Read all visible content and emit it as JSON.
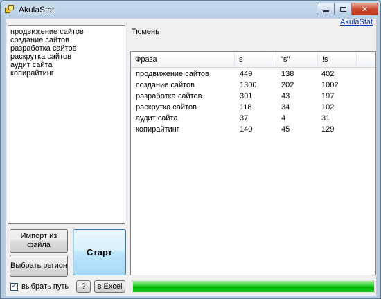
{
  "window": {
    "title": "AkulaStat",
    "controls": {
      "minimize": "",
      "maximize": "",
      "close": "✕"
    }
  },
  "link": "AkulaStat",
  "region_label": "Тюмень",
  "phrases": [
    "продвижение сайтов",
    "создание сайтов",
    "разработка сайтов",
    "раскрутка сайтов",
    "аудит сайта",
    "копирайтинг"
  ],
  "results": {
    "columns": [
      "Фраза",
      "s",
      "\"s\"",
      "!s"
    ],
    "rows": [
      [
        "продвижение сайтов",
        "449",
        "138",
        "402"
      ],
      [
        "создание сайтов",
        "1300",
        "202",
        "1002"
      ],
      [
        "разработка сайтов",
        "301",
        "43",
        "197"
      ],
      [
        "раскрутка сайтов",
        "118",
        "34",
        "102"
      ],
      [
        "аудит сайта",
        "37",
        "4",
        "31"
      ],
      [
        "копирайтинг",
        "140",
        "45",
        "129"
      ]
    ]
  },
  "buttons": {
    "import": "Импорт из файла",
    "region": "Выбрать регион",
    "start": "Старт",
    "help": "?",
    "excel": "в Excel"
  },
  "checkbox": {
    "label": "выбрать путь",
    "checked": true
  },
  "progress": {
    "fraction": 1.0,
    "color": "#06b006"
  },
  "colors": {
    "link": "#0033cc",
    "close_button": "#c43a22",
    "start_button": "#bee6fd"
  }
}
